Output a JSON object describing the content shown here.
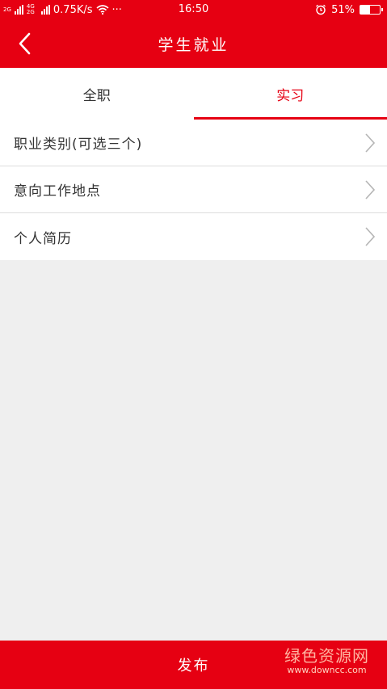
{
  "status_bar": {
    "network_tag_1": "2G",
    "network_tag_2": "4G 2G",
    "speed": "0.75K/s",
    "more": "···",
    "time": "16:50",
    "battery_text": "51%",
    "battery_level": 0.51
  },
  "header": {
    "title": "学生就业"
  },
  "tabs": [
    {
      "label": "全职",
      "active": false
    },
    {
      "label": "实习",
      "active": true
    }
  ],
  "list_items": [
    {
      "label": "职业类别(可选三个)"
    },
    {
      "label": "意向工作地点"
    },
    {
      "label": "个人简历"
    }
  ],
  "bottom": {
    "publish_label": "发布"
  },
  "watermark": {
    "text": "绿色资源网",
    "url": "www.downcc.com"
  },
  "colors": {
    "brand": "#e60012",
    "background": "#efefef"
  }
}
